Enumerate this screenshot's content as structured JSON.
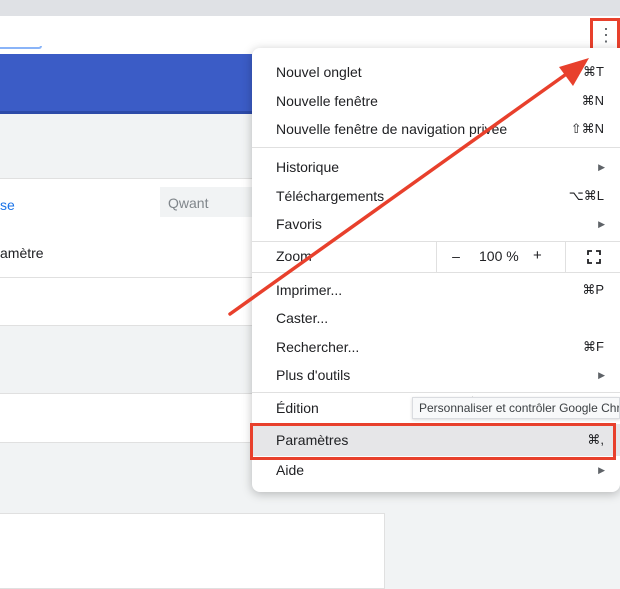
{
  "page": {
    "search_link_partial": "se",
    "search_engine_value": "Qwant",
    "settings_text_partial": "amètre"
  },
  "menu": {
    "group1": [
      {
        "label": "Nouvel onglet",
        "shortcut": "⌘T"
      },
      {
        "label": "Nouvelle fenêtre",
        "shortcut": "⌘N"
      },
      {
        "label": "Nouvelle fenêtre de navigation privée",
        "shortcut": "⇧⌘N"
      }
    ],
    "group2": [
      {
        "label": "Historique",
        "submenu": true
      },
      {
        "label": "Téléchargements",
        "shortcut": "⌥⌘L"
      },
      {
        "label": "Favoris",
        "submenu": true
      }
    ],
    "zoom": {
      "label": "Zoom",
      "minus": "–",
      "value": "100 %",
      "plus": "+"
    },
    "group3": [
      {
        "label": "Imprimer...",
        "shortcut": "⌘P"
      },
      {
        "label": "Caster..."
      },
      {
        "label": "Rechercher...",
        "shortcut": "⌘F"
      },
      {
        "label": "Plus d'outils",
        "submenu": true
      }
    ],
    "edit_label": "Édition",
    "settings": {
      "label": "Paramètres",
      "shortcut": "⌘,"
    },
    "help": {
      "label": "Aide"
    }
  },
  "tooltip": "Personnaliser et contrôler Google Chrome",
  "icons": {
    "menu_button": "kebab-vertical-icon",
    "submenu": "chevron-right-icon",
    "fullscreen": "fullscreen-icon"
  },
  "colors": {
    "annotation": "#e8402c",
    "banner": "#3b5cc6",
    "highlight": "#e6e6e8"
  }
}
